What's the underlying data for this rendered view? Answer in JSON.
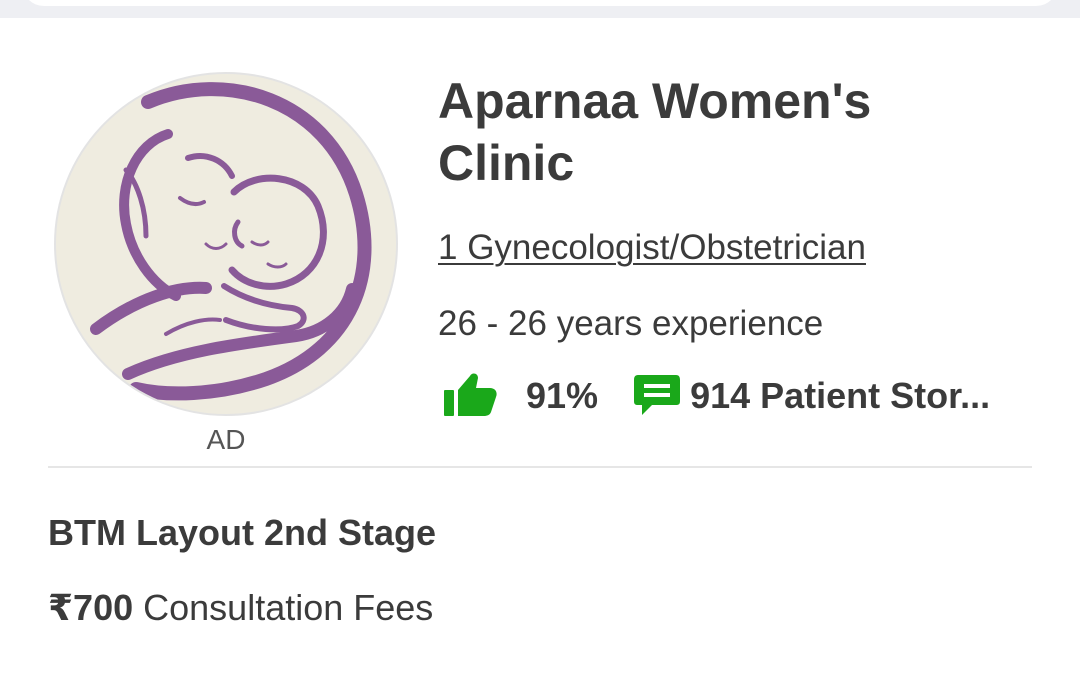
{
  "clinic": {
    "ad_label": "AD",
    "name": "Aparnaa Women's Clinic",
    "specialty": "1 Gynecologist/Obstetrician",
    "experience": "26 - 26 years experience",
    "rating": "91%",
    "patient_stories": "914 Patient Stor...",
    "location": "BTM Layout 2nd Stage",
    "fee_amount": "₹700",
    "fee_label": "Consultation Fees",
    "logo_icon": "mother-baby-logo",
    "rating_icon": "thumbs-up-icon",
    "stories_icon": "chat-bubble-icon"
  },
  "colors": {
    "accent_green": "#1aa81a",
    "logo_purple": "#8a5a98",
    "logo_background": "#efece0",
    "text": "#3b3b3b"
  }
}
